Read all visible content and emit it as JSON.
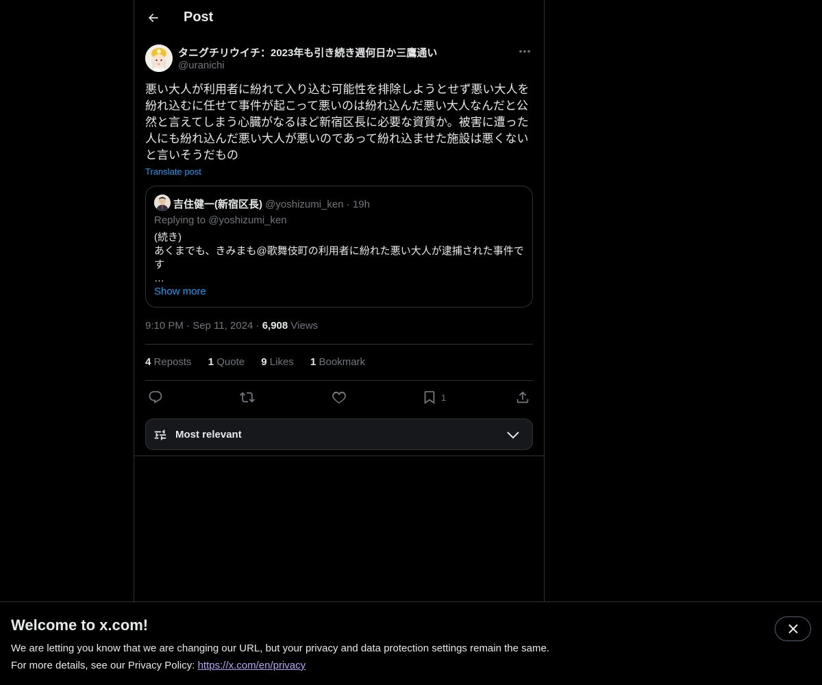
{
  "header": {
    "title": "Post",
    "back_icon": "arrow-left-icon"
  },
  "post": {
    "author_name": "タニグチリウイチ：2023年も引き続き週何日か三鷹通い",
    "author_handle": "@uranichi",
    "more_icon": "more-horizontal-icon",
    "text": "悪い大人が利用者に紛れて入り込む可能性を排除しようとせず悪い大人を紛れ込むに任せて事件が起こって悪いのは紛れ込んだ悪い大人なんだと公然と言えてしまう心臓がなるほど新宿区長に必要な資質か。被害に遭った人にも紛れ込んだ悪い大人が悪いのであって紛れ込ませた施設は悪くないと言いそうだもの",
    "translate_label": "Translate post",
    "time": "9:10 PM",
    "date": "Sep 11, 2024",
    "views_count": "6,908",
    "views_label": "Views",
    "sep": "·"
  },
  "quote": {
    "author_name": "吉住健一(新宿区長)",
    "author_handle": "@yoshizumi_ken",
    "time": "19h",
    "sep": "·",
    "replying_to": "Replying to @yoshizumi_ken",
    "line1": "(続き)",
    "line2": "あくまでも、きみまも@歌舞伎町の利用者に紛れた悪い大人が逮捕された事件です",
    "line3": "…",
    "show_more": "Show more"
  },
  "stats": {
    "reposts_count": "4",
    "reposts_label": "Reposts",
    "quotes_count": "1",
    "quotes_label": "Quote",
    "likes_count": "9",
    "likes_label": "Likes",
    "bookmarks_count": "1",
    "bookmarks_label": "Bookmark"
  },
  "actions": {
    "reply_icon": "reply-icon",
    "repost_icon": "repost-icon",
    "like_icon": "heart-icon",
    "bookmark_icon": "bookmark-icon",
    "bookmark_count": "1",
    "share_icon": "share-icon"
  },
  "sort": {
    "label": "Most relevant",
    "icon": "sliders-icon",
    "chevron": "chevron-down-icon"
  },
  "banner": {
    "title": "Welcome to x.com!",
    "line1": "We are letting you know that we are changing our URL, but your privacy and data protection settings remain the same.",
    "line2_prefix": "For more details, see our Privacy Policy: ",
    "link": "https://x.com/en/privacy",
    "close_icon": "close-icon"
  },
  "colors": {
    "accent": "#1d9bf0",
    "background": "#000000",
    "text": "#e7e9ea",
    "muted": "#71767b",
    "border": "#2f3336",
    "link_visited": "#b6a5f5"
  }
}
